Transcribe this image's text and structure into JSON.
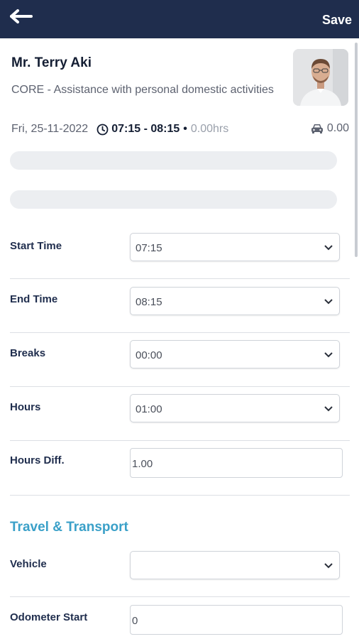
{
  "header": {
    "back_icon": "arrow-left-icon",
    "save_label": "Save",
    "bar_color": "#1f2d4d"
  },
  "client": {
    "name": "Mr. Terry Aki",
    "service": "CORE - Assistance with personal domestic activities",
    "date": "Fri, 25-11-2022",
    "time_range": "07:15 - 08:15",
    "separator": "•",
    "hours": "0.00hrs",
    "travel_amount": "0.00"
  },
  "form": {
    "start_time": {
      "label": "Start Time",
      "value": "07:15"
    },
    "end_time": {
      "label": "End Time",
      "value": "08:15"
    },
    "breaks": {
      "label": "Breaks",
      "value": "00:00"
    },
    "hours": {
      "label": "Hours",
      "value": "01:00"
    },
    "hours_diff": {
      "label": "Hours Diff.",
      "value": "1.00"
    }
  },
  "travel": {
    "section_title": "Travel & Transport",
    "vehicle": {
      "label": "Vehicle",
      "value": ""
    },
    "odometer_start": {
      "label": "Odometer Start",
      "value": "0"
    }
  },
  "colors": {
    "accent": "#3aa0c8",
    "text_dark": "#1f2d4d"
  }
}
